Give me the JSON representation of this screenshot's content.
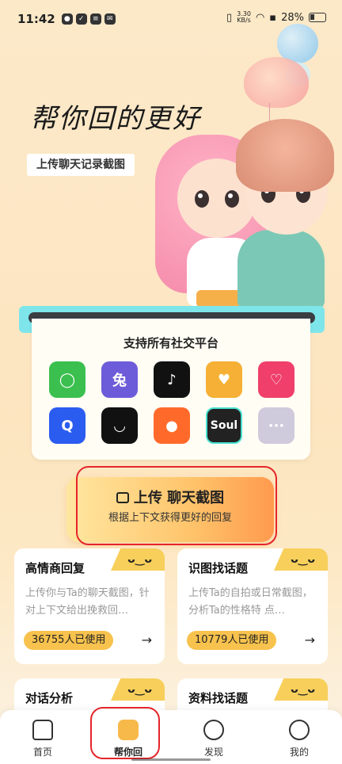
{
  "status_bar": {
    "time": "11:42",
    "net_speed_value": "3.30",
    "net_speed_unit": "KB/s",
    "battery": "28%"
  },
  "hero": {
    "title": "帮你回的更好",
    "upload_chip": "上传聊天记录截图"
  },
  "platforms": {
    "title": "支持所有社交平台",
    "apps": [
      {
        "name": "wechat-app-icon",
        "glyph": "◯",
        "color": "#3bbf4f"
      },
      {
        "name": "rabbit-app-icon",
        "glyph": "兔",
        "color": "#6d5cd9"
      },
      {
        "name": "tiktok-app-icon",
        "glyph": "♪",
        "color": "#111111"
      },
      {
        "name": "duck-app-icon",
        "glyph": "♥",
        "color": "#f5b035"
      },
      {
        "name": "hands-app-icon",
        "glyph": "♡",
        "color": "#ef3f6a"
      },
      {
        "name": "q-app-icon",
        "glyph": "Q",
        "color": "#2b5cf0"
      },
      {
        "name": "smile-app-icon",
        "glyph": "◡",
        "color": "#111111"
      },
      {
        "name": "fox-app-icon",
        "glyph": "●",
        "color": "#ff6a2a"
      },
      {
        "name": "soul-app-icon",
        "glyph": "Soul",
        "color": "#222222"
      },
      {
        "name": "more-app-icon",
        "glyph": "···",
        "color": "#cfcbdc"
      }
    ]
  },
  "upload": {
    "title": "上传 聊天截图",
    "subtitle": "根据上下文获得更好的回复"
  },
  "features": [
    {
      "title": "高情商回复",
      "desc": "上传你与Ta的聊天截图，针对上下文给出挽救回…",
      "count": "36755人已使用"
    },
    {
      "title": "识图找话题",
      "desc": "上传Ta的自拍或日常截图，分析Ta的性格特 点…",
      "count": "10779人已使用"
    },
    {
      "title": "对话分析",
      "desc": "",
      "count": ""
    },
    {
      "title": "资料找话题",
      "desc": "",
      "count": ""
    }
  ],
  "tabs": [
    {
      "label": "首页"
    },
    {
      "label": "帮你回"
    },
    {
      "label": "发现"
    },
    {
      "label": "我的"
    }
  ],
  "colors": {
    "accent": "#f7b94a",
    "highlight_box": "#e5252a"
  }
}
